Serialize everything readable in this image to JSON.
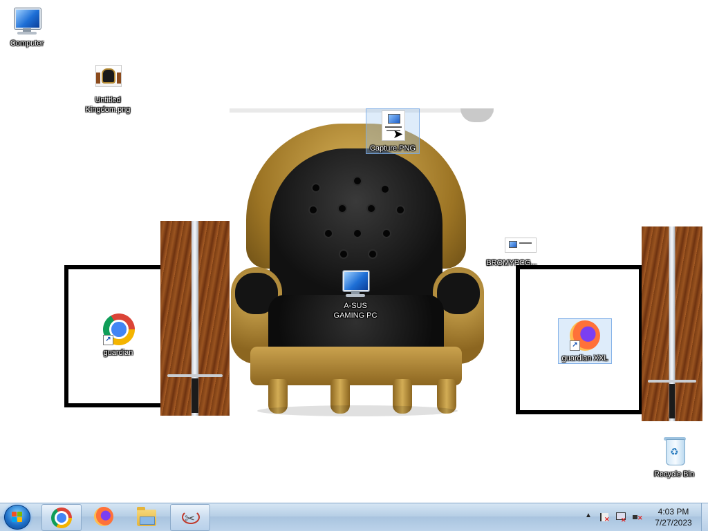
{
  "desktop": {
    "icons": [
      {
        "label": "Computer",
        "icon": "computer-icon"
      },
      {
        "label": "Untitled Kingdom.png",
        "icon": "image-file-icon"
      },
      {
        "label": "Capture.PNG",
        "icon": "image-file-icon"
      },
      {
        "label": "A-SUS GAMING PC",
        "icon": "computer-icon"
      },
      {
        "label": "BROMYPCG...",
        "icon": "image-file-icon"
      },
      {
        "label": "guardian",
        "icon": "chrome-icon"
      },
      {
        "label": "guardian XXL",
        "icon": "firefox-icon"
      },
      {
        "label": "Recycle Bin",
        "icon": "recycle-bin-icon"
      }
    ]
  },
  "taskbar": {
    "start": "start-button",
    "pinned": [
      {
        "name": "Google Chrome",
        "icon": "chrome-icon",
        "active": true
      },
      {
        "name": "Mozilla Firefox",
        "icon": "firefox-icon",
        "active": false
      },
      {
        "name": "File Explorer",
        "icon": "folder-icon",
        "active": false
      },
      {
        "name": "Snipping Tool",
        "icon": "scissors-icon",
        "active": true
      }
    ],
    "clock": {
      "time": "4:03 PM",
      "date": "7/27/2023"
    }
  },
  "colors": {
    "taskbar": "#b7cfe6",
    "desktop_background": "#ffffff",
    "selection": "#a0c8f0"
  }
}
